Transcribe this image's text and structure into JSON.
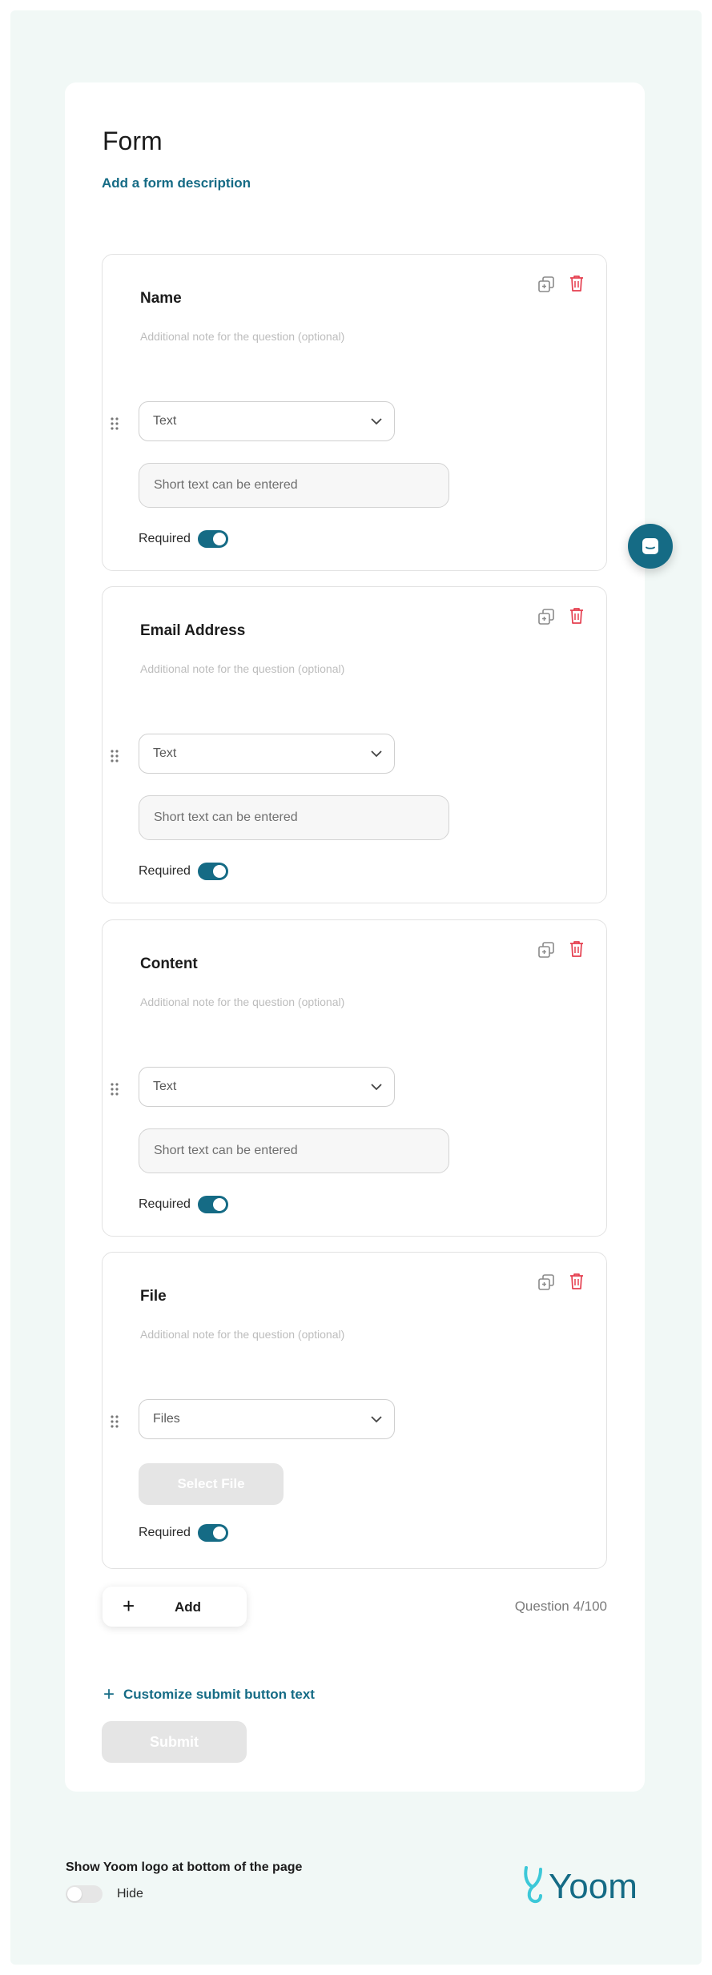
{
  "form": {
    "title": "Form",
    "description_link": "Add a form description"
  },
  "questions": [
    {
      "title": "Name",
      "note_placeholder": "Additional note for the question (optional)",
      "type": "Text",
      "input_placeholder": "Short text can be entered",
      "required_label": "Required",
      "required": true
    },
    {
      "title": "Email Address",
      "note_placeholder": "Additional note for the question (optional)",
      "type": "Text",
      "input_placeholder": "Short text can be entered",
      "required_label": "Required",
      "required": true
    },
    {
      "title": "Content",
      "note_placeholder": "Additional note for the question (optional)",
      "type": "Text",
      "input_placeholder": "Short text can be entered",
      "required_label": "Required",
      "required": true
    },
    {
      "title": "File",
      "note_placeholder": "Additional note for the question (optional)",
      "type": "Files",
      "button_label": "Select File",
      "required_label": "Required",
      "required": true
    }
  ],
  "add_button": {
    "label": "Add"
  },
  "question_count": "Question 4/100",
  "customize_link": "Customize submit button text",
  "submit_button": "Submit",
  "logo_setting": {
    "label": "Show Yoom logo at bottom of the page",
    "toggle_label": "Hide",
    "enabled": false
  },
  "brand": {
    "name": "Yoom"
  },
  "colors": {
    "accent": "#156b85",
    "trash": "#e53e4f",
    "background": "#f1f8f6",
    "logo_mark": "#3cc8d8"
  },
  "icons": {
    "copy": "copy-icon",
    "trash": "trash-icon",
    "drag": "drag-handle-icon",
    "chevron": "chevron-down-icon",
    "chat": "chat-icon",
    "plus": "plus-icon"
  }
}
